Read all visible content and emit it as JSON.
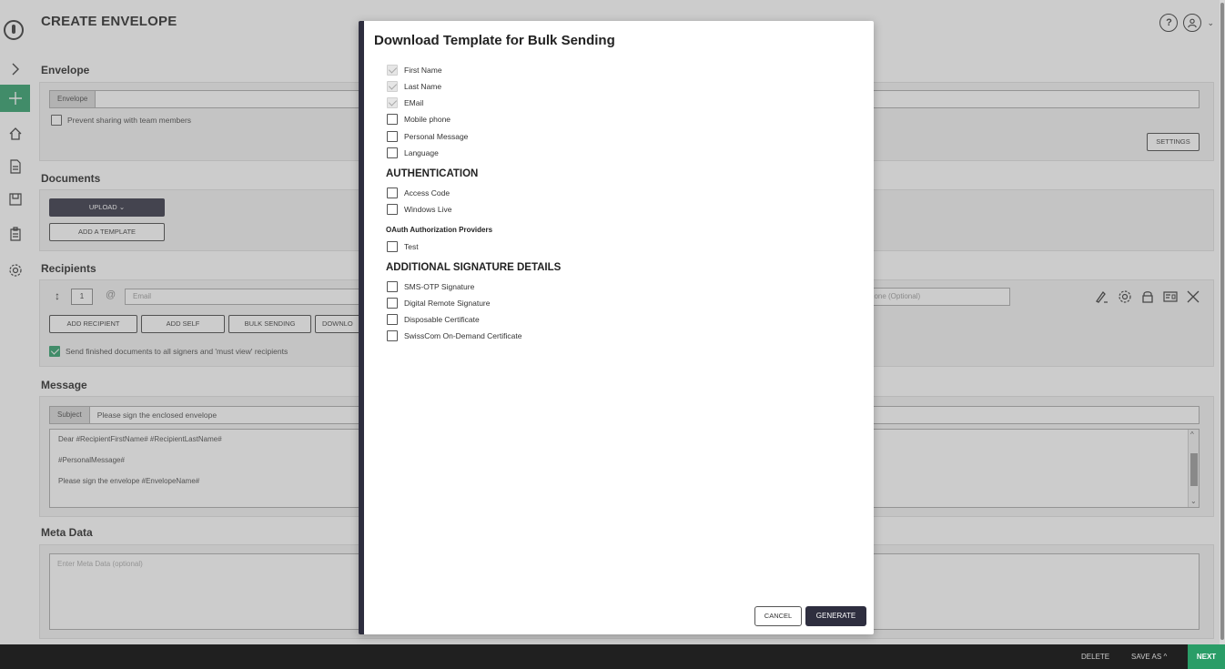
{
  "page": {
    "title": "CREATE ENVELOPE"
  },
  "envelope": {
    "heading": "Envelope",
    "name_label": "Envelope",
    "name_value": "",
    "prevent_sharing": "Prevent sharing with team members",
    "settings_button": "SETTINGS"
  },
  "documents": {
    "heading": "Documents",
    "upload_button": "UPLOAD",
    "add_template_button": "ADD A TEMPLATE"
  },
  "recipients": {
    "heading": "Recipients",
    "order": "1",
    "email_placeholder": "Email",
    "phone_placeholder": "hone (Optional)",
    "buttons": [
      "ADD RECIPIENT",
      "ADD SELF",
      "BULK SENDING",
      "DOWNLO"
    ],
    "send_finished": "Send finished documents to all signers and 'must view' recipients"
  },
  "message": {
    "heading": "Message",
    "subject_label": "Subject",
    "subject_value": "Please sign the enclosed envelope",
    "body_lines": [
      "Dear #RecipientFirstName# #RecipientLastName#",
      "#PersonalMessage#",
      "Please sign the envelope #EnvelopeName#"
    ]
  },
  "meta": {
    "heading": "Meta Data",
    "placeholder": "Enter Meta Data (optional)"
  },
  "bottombar": {
    "delete": "DELETE",
    "save_as": "SAVE AS",
    "next": "NEXT"
  },
  "modal": {
    "title": "Download Template for Bulk Sending",
    "fields": [
      {
        "label": "First Name",
        "checked": true,
        "disabled": true
      },
      {
        "label": "Last Name",
        "checked": true,
        "disabled": true
      },
      {
        "label": "EMail",
        "checked": true,
        "disabled": true
      },
      {
        "label": "Mobile phone",
        "checked": false
      },
      {
        "label": "Personal Message",
        "checked": false
      },
      {
        "label": "Language",
        "checked": false
      }
    ],
    "auth_heading": "AUTHENTICATION",
    "auth_items": [
      "Access Code",
      "Windows Live"
    ],
    "oauth_heading": "OAuth Authorization Providers",
    "oauth_items": [
      "Test"
    ],
    "sig_heading": "ADDITIONAL SIGNATURE DETAILS",
    "sig_items": [
      "SMS-OTP Signature",
      "Digital Remote Signature",
      "Disposable Certificate",
      "SwissCom On-Demand Certificate"
    ],
    "cancel_button": "CANCEL",
    "generate_button": "GENERATE"
  }
}
